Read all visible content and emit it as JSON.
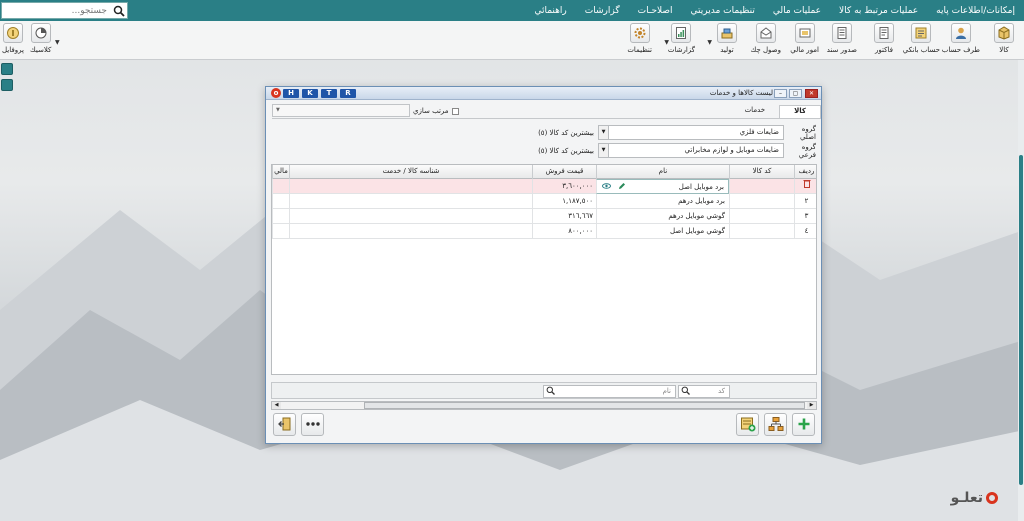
{
  "menu": {
    "items": [
      "إمكانات/اطلاعات پايه",
      "عمليات مرتبط به كالا",
      "عمليات مالي",
      "تنظيمات مديريتي",
      "اصلاحـات",
      "گزارشات",
      "راهنمائي"
    ],
    "search_placeholder": "جستجو..."
  },
  "toolbar": {
    "right": [
      "كالا",
      "طرف حساب",
      "حساب بانكي",
      "فاكتور",
      "صدور سند",
      "امور مالي",
      "وصول چك",
      "توليد",
      "گزارشات",
      "تنظيمات"
    ],
    "left": [
      "كلاسيك",
      "پروفايل"
    ]
  },
  "window": {
    "title": "ليست كالاها و خدمات",
    "hotkeys": [
      "R",
      "T",
      "K",
      "H"
    ],
    "tabs": [
      "كالا",
      "خدمات"
    ],
    "sort_label": "مرتب سازي",
    "main_group_label": "گروه اصلي",
    "main_group_value": "ضايعات فلزي",
    "main_group_note": "بيشترين كد كالا (٥)",
    "sub_group_label": "گروه فرعي",
    "sub_group_value": "ضايعات موبايل و لوازم مخابراتي",
    "sub_group_note": "بيشترين كد كالا (٥)",
    "columns": [
      "رديف",
      "كد كالا",
      "نام",
      "قيمت فروش",
      "شناسه كالا / خدمت",
      "مالي"
    ],
    "rows": [
      {
        "index": "١",
        "code": "",
        "name": "برد موبايل اصل",
        "price": "٣,٦٠٠,٠٠٠"
      },
      {
        "index": "٢",
        "code": "",
        "name": "برد موبايل درهم",
        "price": "١,١٨٧,٥٠٠"
      },
      {
        "index": "٣",
        "code": "",
        "name": "گوشي موبايل درهم",
        "price": "٣١٦,٦٦٧"
      },
      {
        "index": "٤",
        "code": "",
        "name": "گوشي موبايل اصل",
        "price": "٨٠٠,٠٠٠"
      }
    ],
    "filter_code_placeholder": "كد",
    "filter_name_placeholder": "نام"
  },
  "brand": {
    "name": "تعلـو"
  },
  "colors": {
    "accent": "#2a7f86",
    "window_border": "#6b8fb5",
    "selected_row": "#fbe3e6",
    "hotkey": "#1f55a8",
    "add_green": "#2aa34a"
  }
}
